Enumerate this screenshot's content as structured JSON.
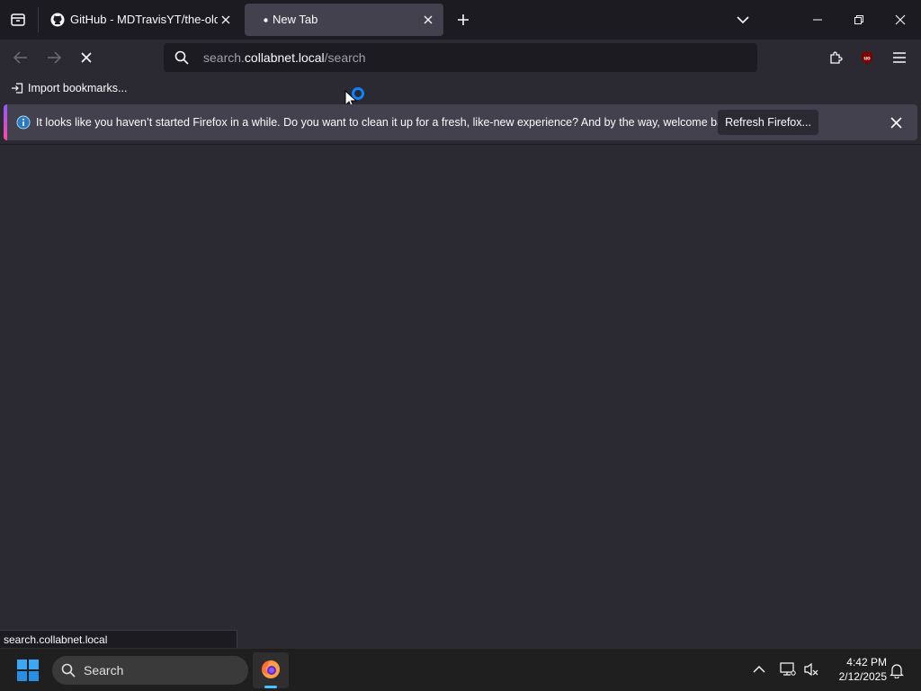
{
  "tabs": [
    {
      "label": "GitHub - MDTravisYT/the-old-c",
      "active": false,
      "icon": "github-icon"
    },
    {
      "label": "New Tab",
      "active": true,
      "icon": "loading-dot-icon"
    }
  ],
  "url": {
    "prefix": "search.",
    "host": "collabnet.local",
    "path": "/search"
  },
  "bookmarks": {
    "import_label": "Import bookmarks..."
  },
  "notification": {
    "message": "It looks like you haven’t started Firefox in a while. Do you want to clean it up for a fresh, like-new experience? And by the way, welcome back!",
    "button_label": "Refresh Firefox...",
    "accent_color": "#9059ff"
  },
  "status_bar": {
    "text": "search.collabnet.local"
  },
  "extensions": {
    "ublock_label": "uo"
  },
  "taskbar": {
    "search_label": "Search",
    "time": "4:42 PM",
    "date": "2/12/2025"
  },
  "colors": {
    "tab_bg": "#1c1b22",
    "toolbar_bg": "#2b2a33",
    "active_tab": "#42414d",
    "accent_blue": "#4cc2ff"
  }
}
